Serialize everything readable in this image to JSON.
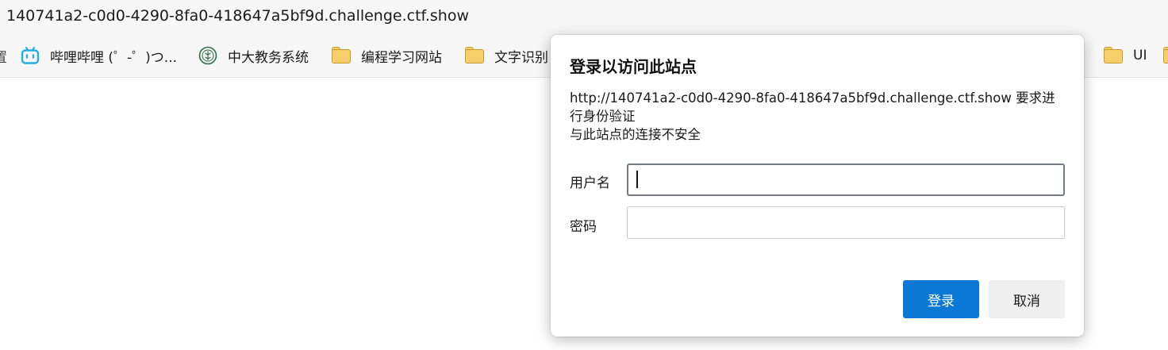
{
  "address_bar": {
    "url": "140741a2-c0d0-4290-8fa0-418647a5bf9d.challenge.ctf.show"
  },
  "bookmarks": {
    "left_edge_glyph": "置",
    "items": [
      {
        "label": "哔哩哔哩 (゜-゜)つ...",
        "icon": "bilibili-icon",
        "accent": "#23ade5"
      },
      {
        "label": "中大教务系统",
        "icon": "university-seal-icon",
        "accent": "#2e6b45"
      },
      {
        "label": "编程学习网站",
        "icon": "folder-icon"
      },
      {
        "label": "文字识别",
        "icon": "folder-icon"
      },
      {
        "label": "UI",
        "icon": "folder-icon"
      }
    ]
  },
  "dialog": {
    "title": "登录以访问此站点",
    "message_line1": "http://140741a2-c0d0-4290-8fa0-418647a5bf9d.challenge.ctf.show 要求进行身份验证",
    "message_line2": "与此站点的连接不安全",
    "username_label": "用户名",
    "username_value": "",
    "password_label": "密码",
    "password_value": "",
    "login_label": "登录",
    "cancel_label": "取消",
    "primary_color": "#0a78d4"
  }
}
